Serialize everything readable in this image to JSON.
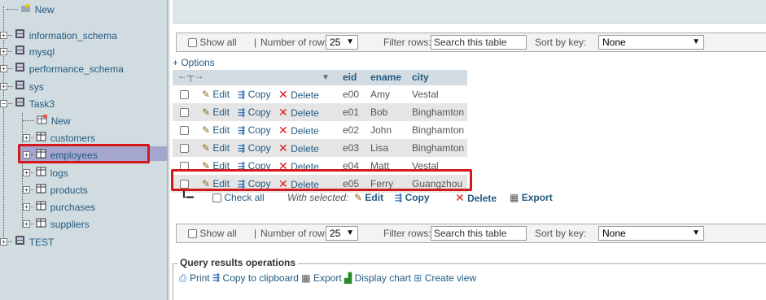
{
  "nav": {
    "items": [
      {
        "label": "New"
      },
      {
        "label": "information_schema"
      },
      {
        "label": "mysql"
      },
      {
        "label": "performance_schema"
      },
      {
        "label": "sys"
      },
      {
        "label": "Task3"
      },
      {
        "label": "New"
      },
      {
        "label": "customers"
      },
      {
        "label": "employees"
      },
      {
        "label": "logs"
      },
      {
        "label": "products"
      },
      {
        "label": "purchases"
      },
      {
        "label": "suppliers"
      },
      {
        "label": "TEST"
      }
    ]
  },
  "navbar": {
    "show_all": "Show all",
    "number_of_rows_label": "Number of rows:",
    "rows_value": "25",
    "filter_label": "Filter rows:",
    "filter_placeholder": "Search this table",
    "sort_label": "Sort by key:",
    "sort_value": "None"
  },
  "options_link": "+ Options",
  "table": {
    "columns": [
      "eid",
      "ename",
      "city"
    ],
    "row_actions": {
      "edit": "Edit",
      "copy": "Copy",
      "delete": "Delete"
    },
    "rows": [
      {
        "eid": "e00",
        "ename": "Amy",
        "city": "Vestal"
      },
      {
        "eid": "e01",
        "ename": "Bob",
        "city": "Binghamton"
      },
      {
        "eid": "e02",
        "ename": "John",
        "city": "Binghamton"
      },
      {
        "eid": "e03",
        "ename": "Lisa",
        "city": "Binghamton"
      },
      {
        "eid": "e04",
        "ename": "Matt",
        "city": "Vestal"
      },
      {
        "eid": "e05",
        "ename": "Ferry",
        "city": "Guangzhou"
      }
    ]
  },
  "with_selected": {
    "check_all": "Check all",
    "label": "With selected:",
    "edit": "Edit",
    "copy": "Copy",
    "delete": "Delete",
    "export": "Export"
  },
  "query_results": {
    "legend": "Query results operations",
    "print": "Print",
    "copy_clipboard": "Copy to clipboard",
    "export": "Export",
    "display_chart": "Display chart",
    "create_view": "Create view"
  },
  "colors": {
    "nav_bg": "#d0dce0",
    "selected_nav": "#a5a6ce",
    "highlight": "#d4181b",
    "link": "#235a81",
    "delete": "#e01b1b"
  }
}
